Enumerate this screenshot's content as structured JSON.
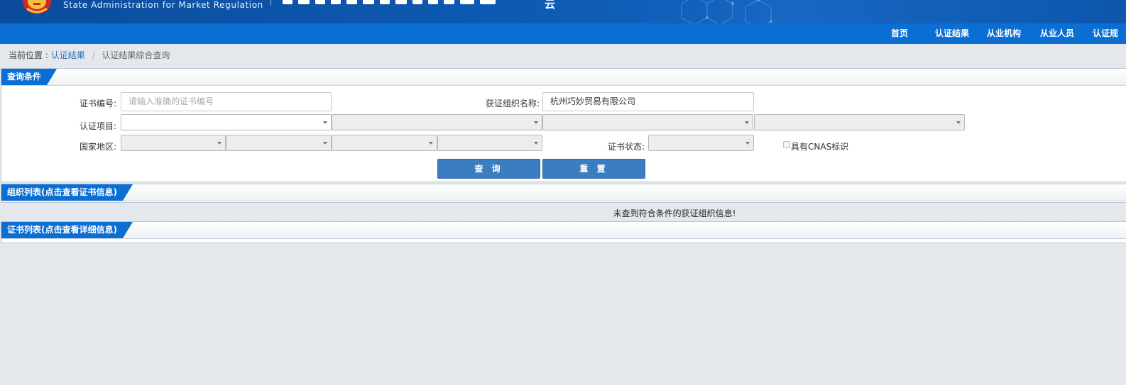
{
  "header": {
    "org_en": "State Administration  for  Market Regulation",
    "cut_title_glyph": "云"
  },
  "nav": {
    "items": [
      "首页",
      "认证结果",
      "从业机构",
      "从业人员",
      "认证规"
    ]
  },
  "breadcrumb": {
    "prefix": "当前位置 :",
    "link": "认证结果",
    "separator": "/",
    "current": "认证结果综合查询"
  },
  "query": {
    "panel_title": "查询条件",
    "cert_no_label": "证书编号:",
    "cert_no_placeholder": "请输入准确的证书编号",
    "org_name_label": "获证组织名称:",
    "org_name_value": "杭州巧妙贸易有限公司",
    "cert_item_label": "认证项目:",
    "region_label": "国家地区:",
    "status_label": "证书状态:",
    "cnas_label": "具有CNAS标识",
    "search_button": "查 询",
    "reset_button": "重 置"
  },
  "org_list": {
    "panel_title": "组织列表(点击查看证书信息)",
    "empty_message": "未查到符合条件的获证组织信息!"
  },
  "cert_list": {
    "panel_title": "证书列表(点击查看详细信息)"
  },
  "colors": {
    "nav_bg": "#0a6ed3",
    "banner_bg": "#0b4c9c",
    "button_bg": "#3a7dc1",
    "link": "#2a6ebb"
  }
}
